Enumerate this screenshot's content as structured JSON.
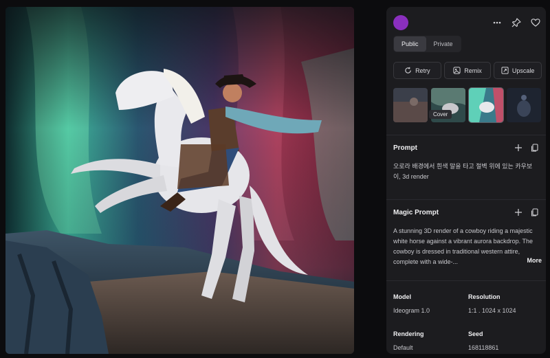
{
  "visibility": {
    "tabs": [
      "Public",
      "Private"
    ],
    "active": "Public"
  },
  "actions": {
    "retry": "Retry",
    "remix": "Remix",
    "upscale": "Upscale"
  },
  "thumbnails": {
    "cover_tooltip": "Cover"
  },
  "prompt": {
    "title": "Prompt",
    "text": "오로라 배경에서 흰색 말을 타고 절벽 위에 있는 카우보이, 3d render"
  },
  "magic_prompt": {
    "title": "Magic Prompt",
    "text": "A stunning 3D render of a cowboy riding a majestic white horse against a vibrant aurora backdrop. The cowboy is dressed in traditional western attire, complete with a wide-...",
    "more": "More"
  },
  "details": {
    "model_label": "Model",
    "model_value": "Ideogram 1.0",
    "resolution_label": "Resolution",
    "resolution_value": "1:1 . 1024 x 1024",
    "rendering_label": "Rendering",
    "rendering_value": "Default",
    "seed_label": "Seed",
    "seed_value": "168118861"
  },
  "colors": {
    "avatar": "#8a2fbe",
    "panel_bg": "#1c1c1f",
    "page_bg": "#0c0c0e"
  },
  "icons": {
    "header": [
      "more-horizontal-icon",
      "pin-icon",
      "heart-icon"
    ],
    "retry": "refresh-icon",
    "remix": "remix-icon",
    "upscale": "upscale-icon",
    "section": [
      "plus-icon",
      "copy-icon"
    ]
  }
}
